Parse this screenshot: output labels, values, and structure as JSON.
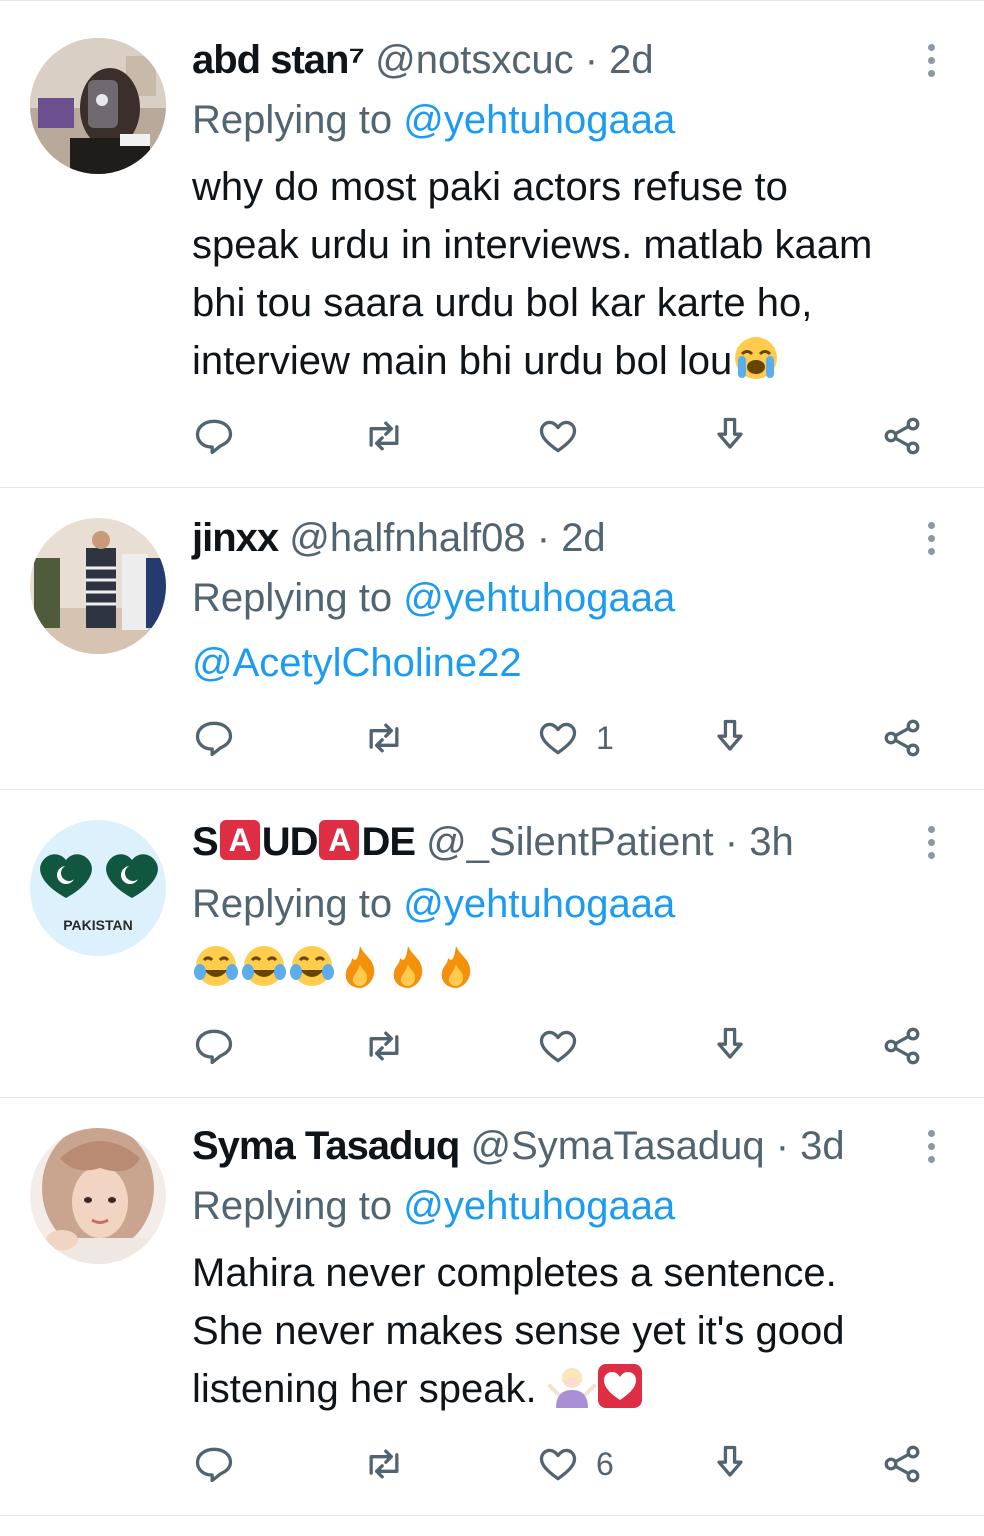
{
  "tweets": [
    {
      "name": "abd stan⁷",
      "handle": "@notsxcuc",
      "dot": "·",
      "time": "2d",
      "replying_prefix": "Replying to",
      "replying_to": "@yehtuhogaaa",
      "text_lines": [
        "why do most paki actors refuse to",
        "speak urdu in interviews. matlab kaam",
        "bhi tou saara urdu bol kar karte ho,",
        "interview main bhi urdu bol lou"
      ],
      "emojis": [
        "loudly-crying-face"
      ],
      "likes": ""
    },
    {
      "name": "jinxx",
      "handle": "@halfnhalf08",
      "dot": "·",
      "time": "2d",
      "replying_prefix": "Replying to",
      "replying_to": "@yehtuhogaaa",
      "text_mention": "@AcetylCholine22",
      "likes": "1"
    },
    {
      "name_parts": [
        "S",
        "A",
        "UD",
        "A",
        "DE"
      ],
      "handle": "@_SilentPatient",
      "dot": "·",
      "time": "3h",
      "replying_prefix": "Replying to",
      "replying_to": "@yehtuhogaaa",
      "emojis": [
        "face-with-tears-of-joy",
        "face-with-tears-of-joy",
        "face-with-tears-of-joy",
        "fire",
        "fire",
        "fire"
      ],
      "avatar_text": "PAKISTAN",
      "likes": ""
    },
    {
      "name": "Syma Tasaduq",
      "handle": "@SymaTasaduq",
      "dot": "·",
      "time": "3d",
      "replying_prefix": "Replying to",
      "replying_to": "@yehtuhogaaa",
      "text_lines": [
        "Mahira never completes a sentence.",
        "She never makes sense yet it's good",
        "listening her speak. "
      ],
      "emojis": [
        "person-shrugging",
        "heart-white-in-red-box"
      ],
      "likes": "6"
    }
  ],
  "icons": [
    "reply-icon",
    "retweet-icon",
    "like-icon",
    "download-icon",
    "share-icon",
    "more-icon"
  ],
  "colors": {
    "link": "#1d9bf0",
    "secondary": "#536471",
    "text": "#0f1419",
    "divider": "#e3e7ea"
  }
}
